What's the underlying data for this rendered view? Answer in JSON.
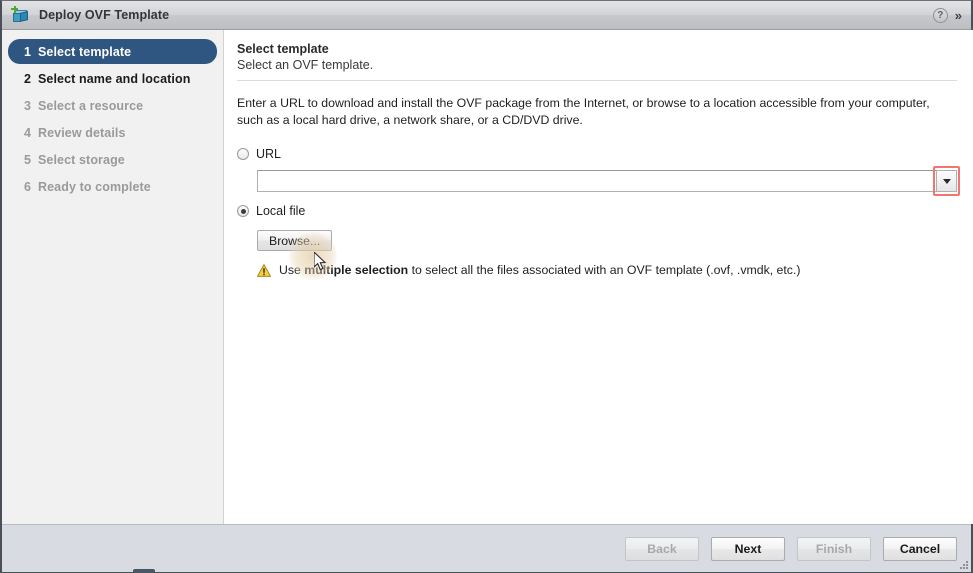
{
  "window": {
    "title": "Deploy OVF Template",
    "icon": "ovf-template-icon",
    "help_label": "?",
    "collapse_label": "»"
  },
  "sidebar": {
    "steps": [
      {
        "num": "1",
        "label": "Select template",
        "state": "active"
      },
      {
        "num": "2",
        "label": "Select name and location",
        "state": "done"
      },
      {
        "num": "3",
        "label": "Select a resource",
        "state": "pending"
      },
      {
        "num": "4",
        "label": "Review details",
        "state": "pending"
      },
      {
        "num": "5",
        "label": "Select storage",
        "state": "pending"
      },
      {
        "num": "6",
        "label": "Ready to complete",
        "state": "pending"
      }
    ]
  },
  "content": {
    "section_title": "Select template",
    "section_subtitle": "Select an OVF template.",
    "description": "Enter a URL to download and install the OVF package from the Internet, or browse to a location accessible from your computer, such as a local hard drive, a network share, or a CD/DVD drive.",
    "url_option": {
      "label": "URL",
      "selected": false,
      "value": "",
      "placeholder": "",
      "dropdown_icon": "chevron-down-icon",
      "highlight_color": "#f4756e"
    },
    "local_option": {
      "label": "Local file",
      "selected": true,
      "browse_label": "Browse..."
    },
    "warning": {
      "icon": "warning-triangle-icon",
      "text_before": "Use ",
      "text_bold": "multiple selection",
      "text_after": " to select all the files associated with an OVF template (.ovf, .vmdk, etc.)"
    }
  },
  "footer": {
    "buttons": [
      {
        "label": "Back",
        "enabled": false
      },
      {
        "label": "Next",
        "enabled": true
      },
      {
        "label": "Finish",
        "enabled": false
      },
      {
        "label": "Cancel",
        "enabled": true
      }
    ]
  },
  "colors": {
    "accent_blue": "#2e5680",
    "highlight_red": "#f4756e",
    "warning_yellow": "#f2c43d",
    "footer_bg": "#d8dce2",
    "sidebar_bg": "#f1f1f1"
  }
}
